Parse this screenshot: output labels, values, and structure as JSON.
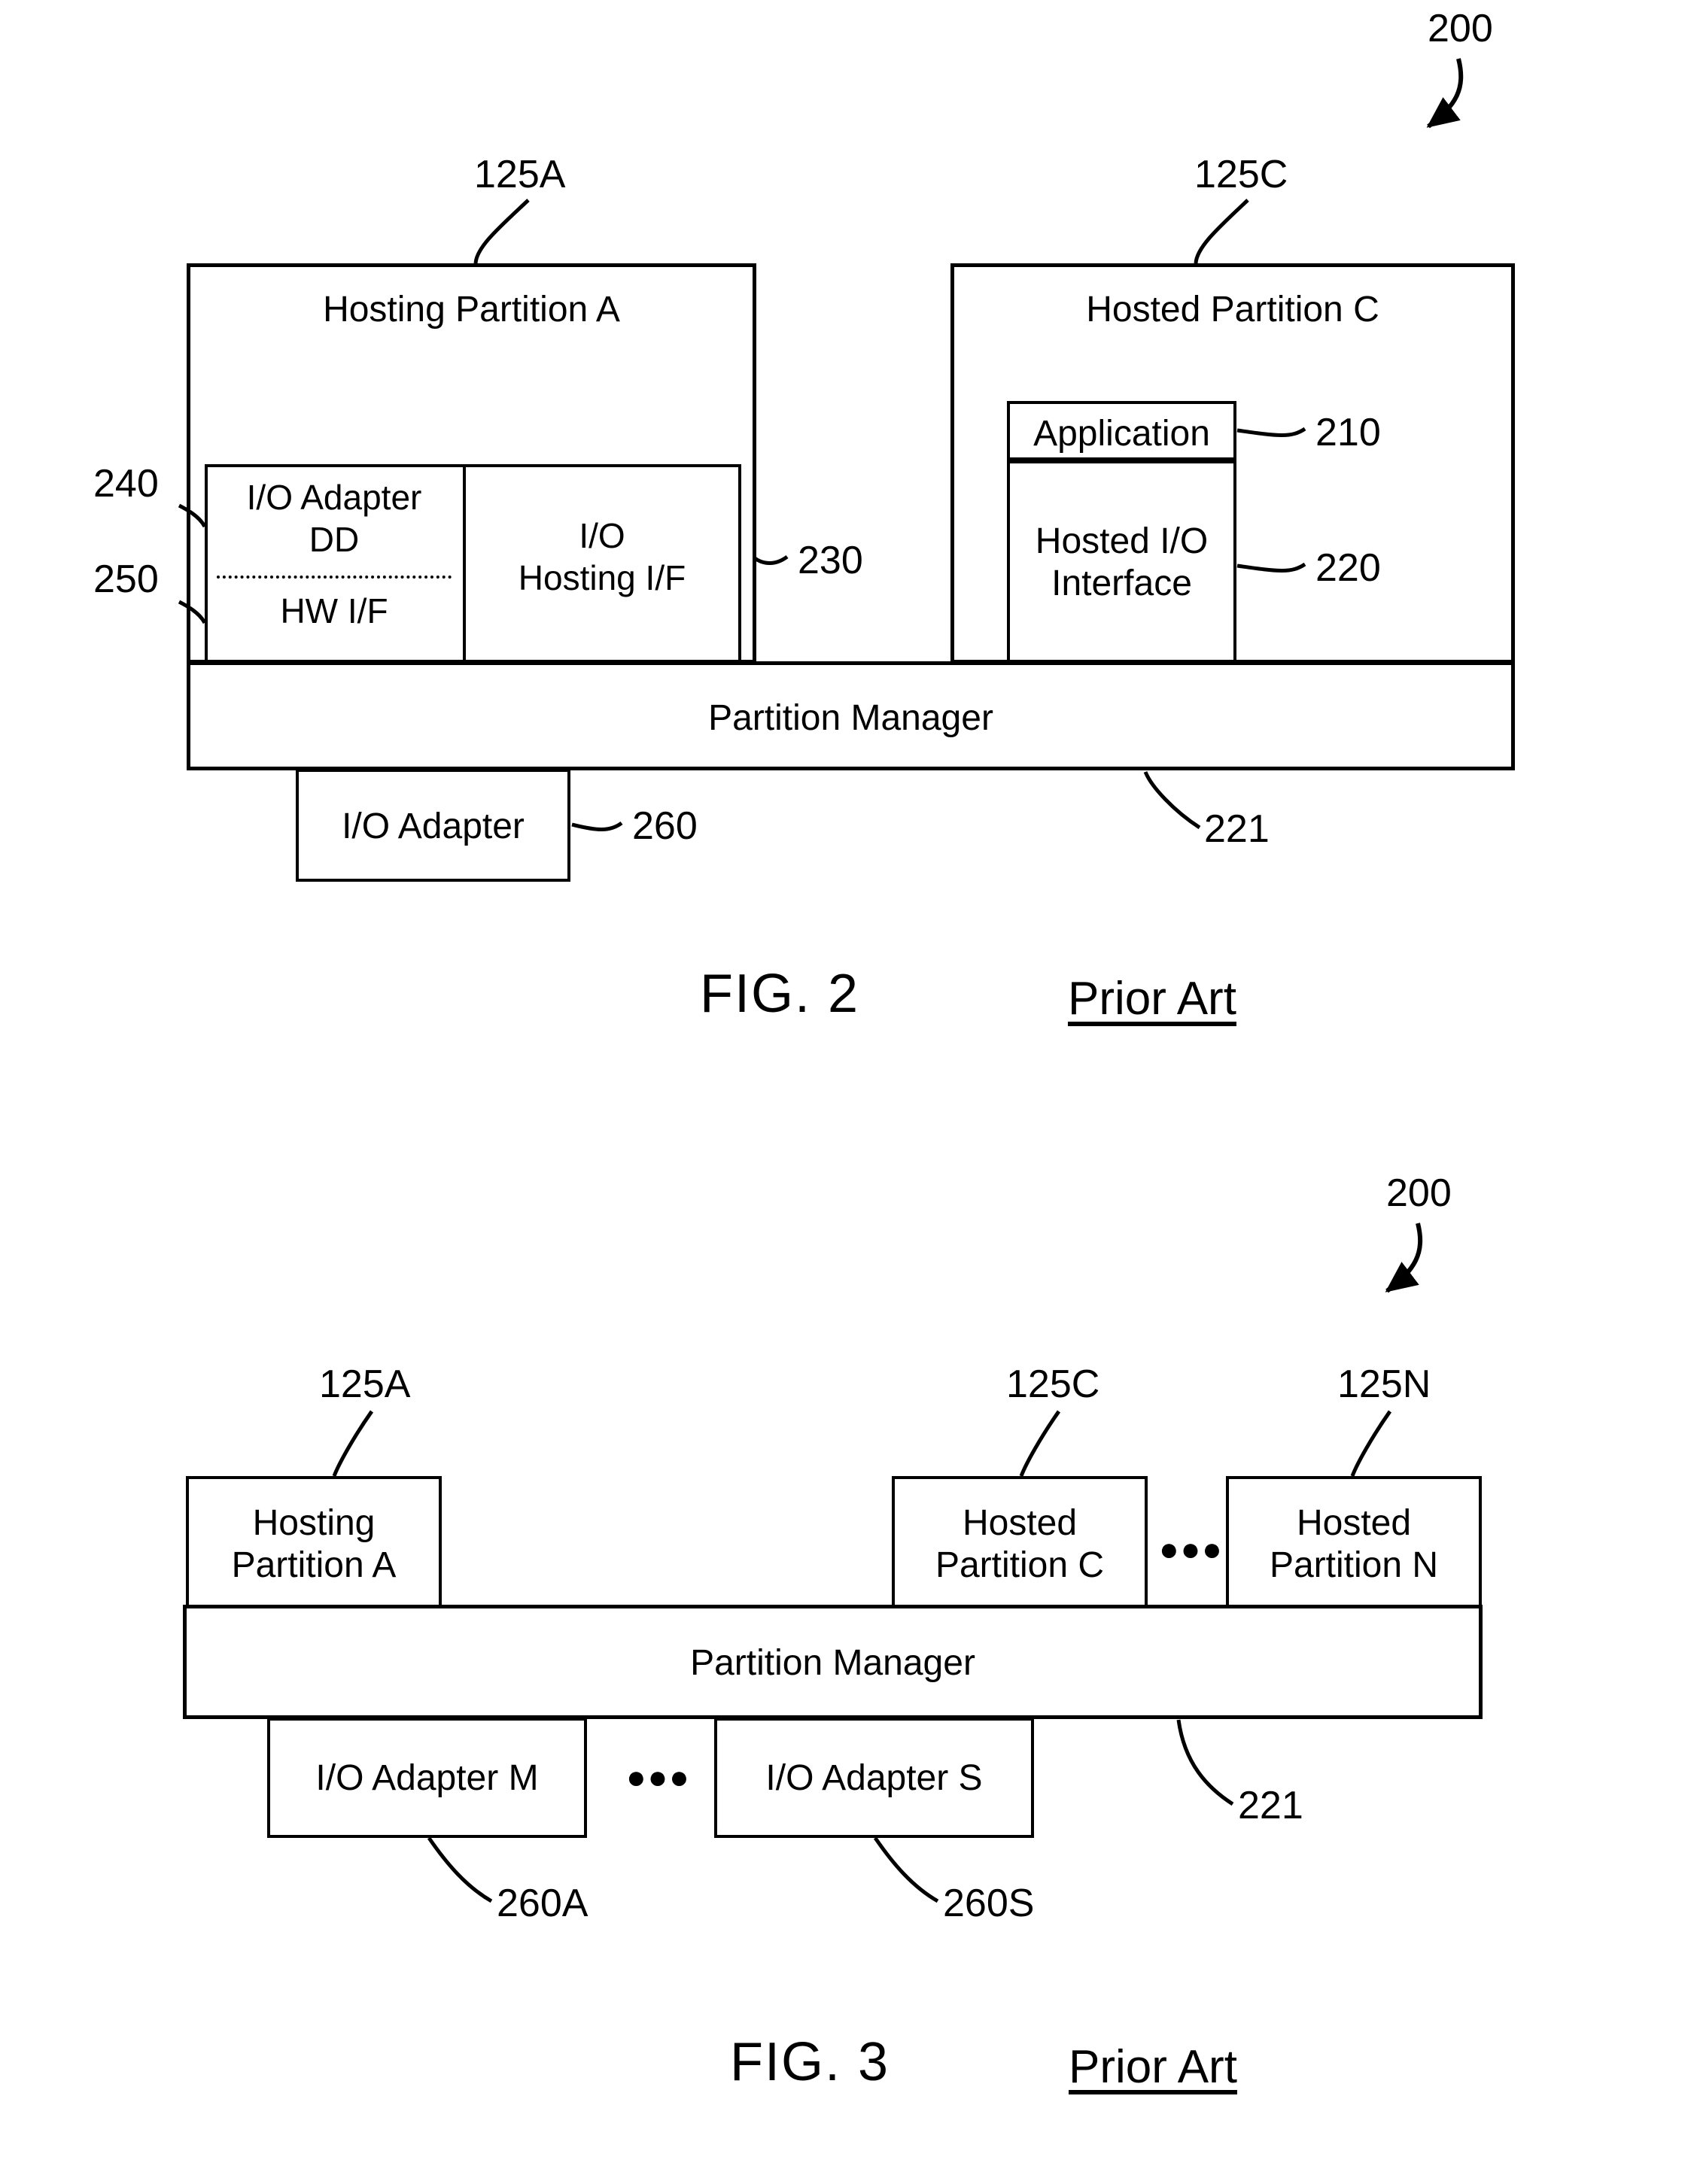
{
  "figures": [
    {
      "id": "fig2",
      "caption": "FIG. 2",
      "note": "Prior Art",
      "system_ref": "200",
      "left_partition": {
        "ref": "125A",
        "title": "Hosting Partition A",
        "inner_left": {
          "ref_top": "240",
          "ref_bottom": "250",
          "top_label": "I/O Adapter DD",
          "top_label_line1": "I/O Adapter",
          "top_label_line2": "DD",
          "bottom_label": "HW I/F"
        },
        "inner_right": {
          "ref": "230",
          "label_line1": "I/O",
          "label_line2": "Hosting I/F"
        }
      },
      "right_partition": {
        "ref": "125C",
        "title": "Hosted Partition C",
        "application": {
          "ref": "210",
          "label": "Application"
        },
        "hosted_io": {
          "ref": "220",
          "label_line1": "Hosted I/O",
          "label_line2": "Interface"
        }
      },
      "partition_manager": {
        "ref": "221",
        "label": "Partition Manager"
      },
      "io_adapter": {
        "ref": "260",
        "label": "I/O Adapter"
      }
    },
    {
      "id": "fig3",
      "caption": "FIG. 3",
      "note": "Prior Art",
      "system_ref": "200",
      "partitions": [
        {
          "ref": "125A",
          "line1": "Hosting",
          "line2": "Partition A"
        },
        {
          "ref": "125C",
          "line1": "Hosted",
          "line2": "Partition C"
        },
        {
          "ref": "125N",
          "line1": "Hosted",
          "line2": "Partition N"
        }
      ],
      "partition_ellipsis": "●●●",
      "partition_manager": {
        "ref": "221",
        "label": "Partition Manager"
      },
      "adapters": [
        {
          "ref": "260A",
          "label": "I/O Adapter M"
        },
        {
          "ref": "260S",
          "label": "I/O Adapter S"
        }
      ],
      "adapter_ellipsis": "●●●"
    }
  ],
  "colors": {
    "stroke": "#000000",
    "background": "#ffffff"
  }
}
